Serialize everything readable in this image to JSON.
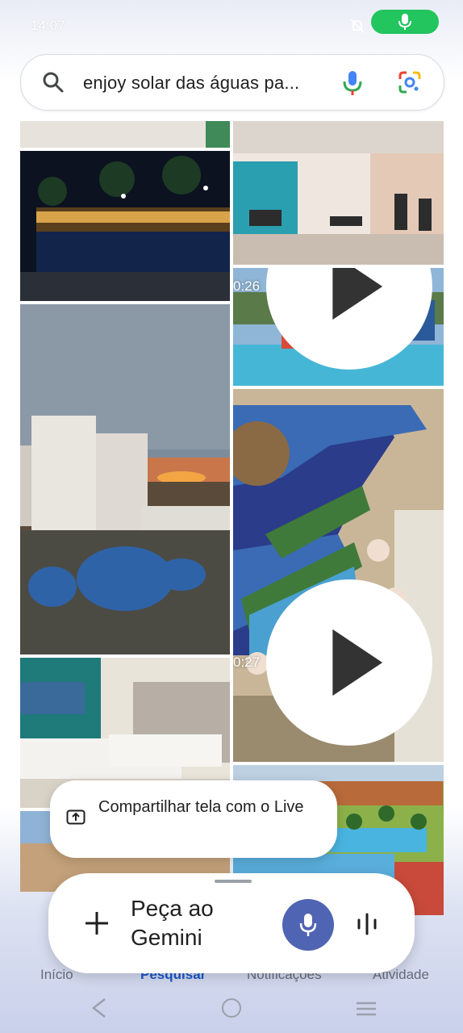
{
  "status_bar": {
    "time": "14:07"
  },
  "search": {
    "query": "enjoy solar das águas pa..."
  },
  "videos": {
    "waterpark_duration": "0:26",
    "aerial_duration": "0:27"
  },
  "bottom_nav": {
    "items": [
      {
        "label": "Início"
      },
      {
        "label": "Pesquisar"
      },
      {
        "label": "Notificações"
      },
      {
        "label": "Atividade"
      }
    ]
  },
  "share_live": {
    "label": "Compartilhar tela com o Live"
  },
  "gemini": {
    "placeholder": "Peça ao Gemini"
  },
  "colors": {
    "mic_pill": "#22c55e",
    "gemini_mic": "#4f64b2",
    "active_nav": "#1a56c8"
  }
}
